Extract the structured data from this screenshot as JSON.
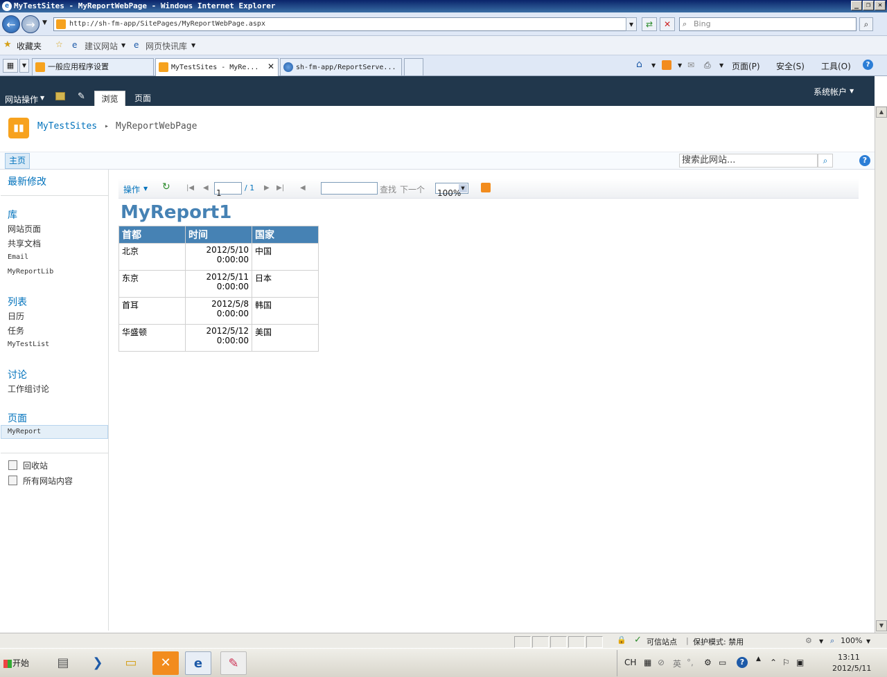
{
  "window": {
    "title": "MyTestSites - MyReportWebPage - Windows Internet Explorer"
  },
  "address_bar": {
    "url": "http://sh-fm-app/SitePages/MyReportWebPage.aspx",
    "search_placeholder": "Bing"
  },
  "favorites_bar": {
    "favorites_label": "收藏夹",
    "items": [
      "建议网站",
      "网页快讯库"
    ]
  },
  "tabs": [
    {
      "label": "一般应用程序设置"
    },
    {
      "label": "MyTestSites - MyRe..."
    },
    {
      "label": "sh-fm-app/ReportServe..."
    }
  ],
  "command_bar": {
    "page": "页面(P)",
    "safety": "安全(S)",
    "tools": "工具(O)"
  },
  "ribbon": {
    "site_actions": "网站操作",
    "tab_browse": "浏览",
    "tab_page": "页面",
    "account": "系统帐户"
  },
  "breadcrumb": {
    "site": "MyTestSites",
    "separator": "▸",
    "page": "MyReportWebPage"
  },
  "top_nav": {
    "home": "主页",
    "search_placeholder": "搜索此网站..."
  },
  "left_nav": {
    "recent": "最新修改",
    "libraries": {
      "heading": "库",
      "items": [
        "网站页面",
        "共享文档",
        "Email",
        "MyReportLib"
      ]
    },
    "lists": {
      "heading": "列表",
      "items": [
        "日历",
        "任务",
        "MyTestList"
      ]
    },
    "discussions": {
      "heading": "讨论",
      "items": [
        "工作组讨论"
      ]
    },
    "pages": {
      "heading": "页面",
      "items": [
        "MyReport"
      ]
    },
    "recycle_bin": "回收站",
    "all_content": "所有网站内容"
  },
  "report_toolbar": {
    "actions": "操作",
    "page_current": "1",
    "page_total": "/ 1",
    "find": "查找",
    "next": "下一个",
    "zoom": "100%"
  },
  "report": {
    "title": "MyReport1",
    "columns": [
      "首都",
      "时间",
      "国家"
    ],
    "rows": [
      {
        "capital": "北京",
        "date": "2012/5/10",
        "time": "0:00:00",
        "country": "中国"
      },
      {
        "capital": "东京",
        "date": "2012/5/11",
        "time": "0:00:00",
        "country": "日本"
      },
      {
        "capital": "首耳",
        "date": "2012/5/8",
        "time": "0:00:00",
        "country": "韩国"
      },
      {
        "capital": "华盛顿",
        "date": "2012/5/12",
        "time": "0:00:00",
        "country": "美国"
      }
    ]
  },
  "status_bar": {
    "trusted": "可信站点",
    "protected_mode": "保护模式: 禁用",
    "zoom": "100%"
  },
  "taskbar": {
    "start": "开始",
    "ime_lang": "CH",
    "ime_mode": "英",
    "clock_time": "13:11",
    "clock_date": "2012/5/11"
  },
  "colors": {
    "ribbon_bg": "#21374c",
    "report_header": "#4682b4",
    "link": "#0072bc",
    "logo": "#f7a21e"
  }
}
